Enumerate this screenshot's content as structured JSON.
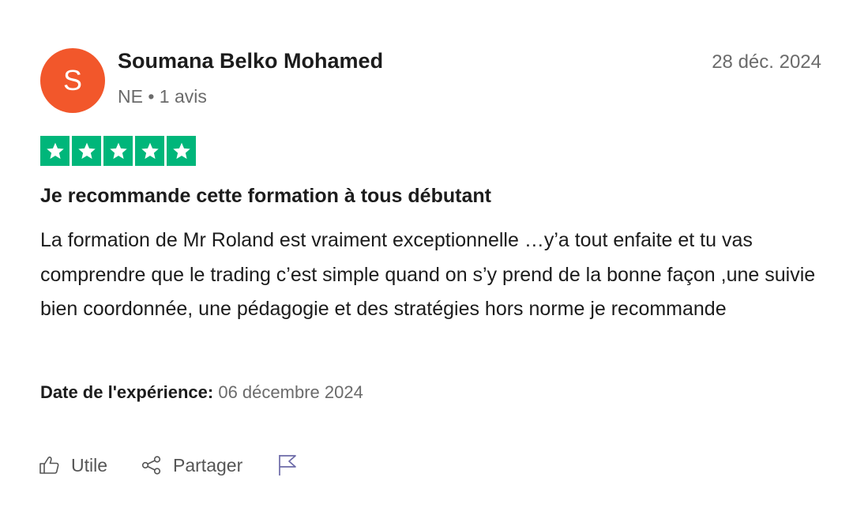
{
  "reviewer": {
    "initial": "S",
    "name": "Soumana Belko Mohamed",
    "country": "NE",
    "separator": "•",
    "review_count": "1 avis"
  },
  "review": {
    "date": "28 déc. 2024",
    "rating": 5,
    "rating_max": 5,
    "title": "Je recommande cette formation à tous débutant",
    "body": "La formation de Mr Roland est vraiment exceptionnelle …y’a tout enfaite et tu vas comprendre que le trading c’est simple quand on s’y prend de la bonne façon ,une suivie bien coordonnée, une pédagogie et des stratégies hors norme je recommande",
    "experience_label": "Date de l'expérience:",
    "experience_date": "06 décembre 2024"
  },
  "actions": {
    "useful_label": "Utile",
    "share_label": "Partager"
  },
  "colors": {
    "avatar": "#f2572b",
    "star": "#00b67a",
    "flag": "#6c6aa8"
  },
  "icons": [
    "thumbs-up-icon",
    "share-icon",
    "flag-icon",
    "star-icon"
  ]
}
